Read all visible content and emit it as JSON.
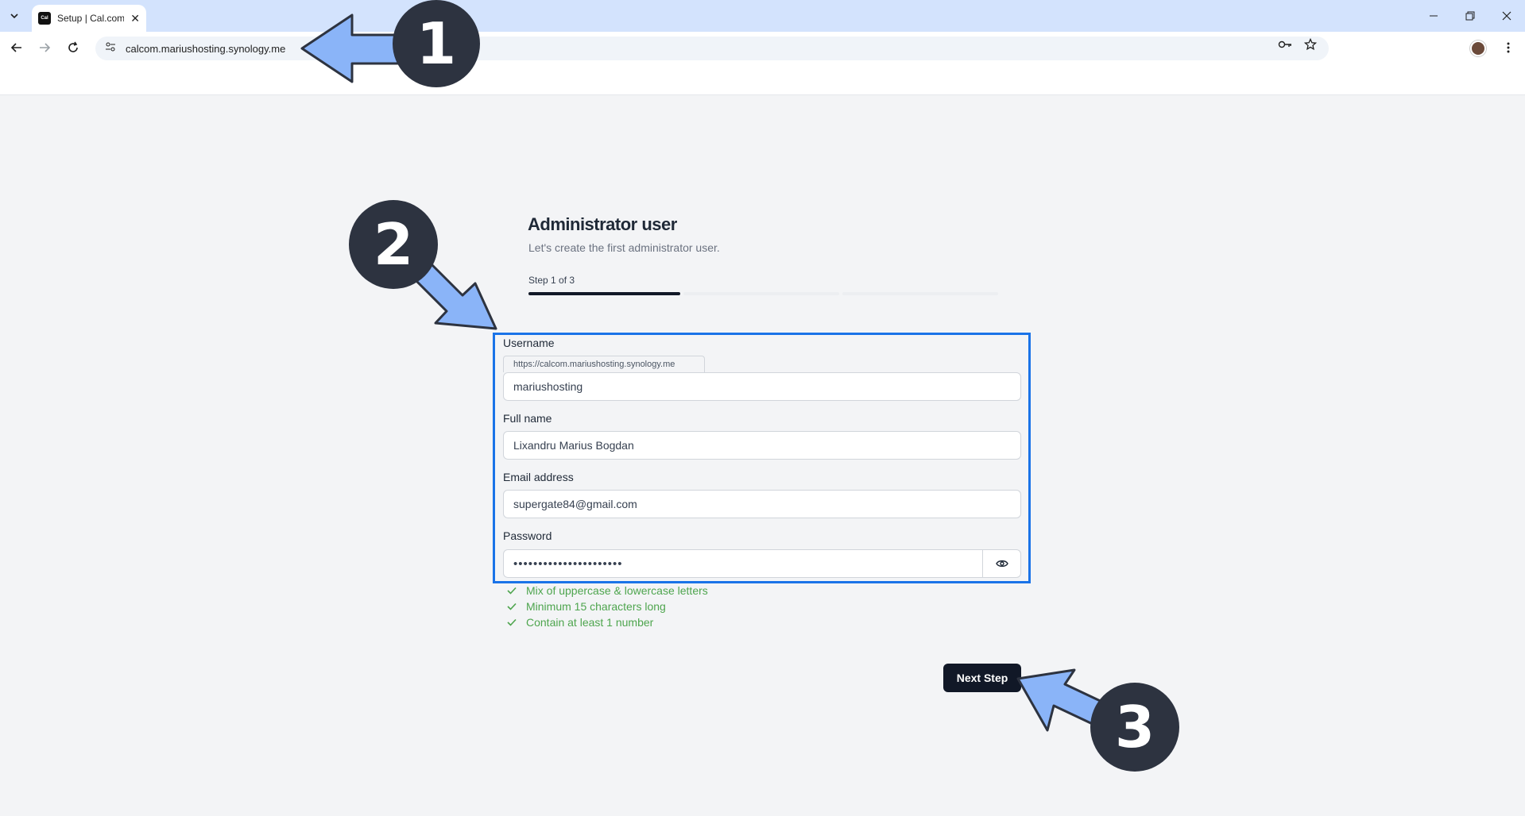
{
  "browser": {
    "tab_title": "Setup | Cal.com",
    "favicon_text": "Cal",
    "url": "calcom.mariushosting.synology.me"
  },
  "page": {
    "heading": "Administrator user",
    "subheading": "Let's create the first administrator user.",
    "step_label": "Step 1 of 3",
    "progress_current_step": 1,
    "progress_total_steps": 3
  },
  "form": {
    "username_label": "Username",
    "username_prefix": "https://calcom.mariushosting.synology.me",
    "username_value": "mariushosting",
    "fullname_label": "Full name",
    "fullname_value": "Lixandru Marius Bogdan",
    "email_label": "Email address",
    "email_value": "supergate84@gmail.com",
    "password_label": "Password",
    "password_value": "••••••••••••••••••••••",
    "rules": [
      "Mix of uppercase & lowercase letters",
      "Minimum 15 characters long",
      "Contain at least 1 number"
    ],
    "next_button": "Next Step"
  },
  "annotations": {
    "badge_1": "1",
    "badge_2": "2",
    "badge_3": "3",
    "arrow_color": "#8ab4f8",
    "badge_color": "#2d3340",
    "highlight_color": "#1a73e8"
  },
  "icons": [
    "tab-list-icon",
    "close-icon",
    "minimize-icon",
    "restore-icon",
    "back-icon",
    "forward-icon",
    "reload-icon",
    "site-info-icon",
    "password-key-icon",
    "bookmark-star-icon",
    "kebab-menu-icon",
    "eye-icon",
    "check-icon"
  ]
}
